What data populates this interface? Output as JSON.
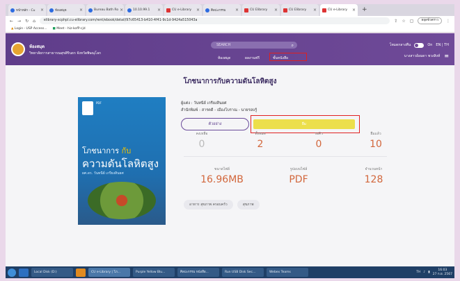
{
  "browser": {
    "tabs": [
      {
        "label": "หน้าหลัก - Cu",
        "icon": "page-icon",
        "active": false
      },
      {
        "label": "ห้องสมุด",
        "icon": "page-icon",
        "active": false
      },
      {
        "label": "Bureau Bath Ro",
        "icon": "page-icon",
        "active": false
      },
      {
        "label": "10.10.99.1",
        "icon": "page-icon",
        "active": false
      },
      {
        "label": "CU e-Library",
        "icon": "cu-icon",
        "active": false
      },
      {
        "label": "ศิลปะกรรม",
        "icon": "page-icon",
        "active": false
      },
      {
        "label": "CU Elibrary",
        "icon": "cu-icon",
        "active": false
      },
      {
        "label": "CU Elibrary",
        "icon": "cu-icon",
        "active": false
      },
      {
        "label": "CU e-Library",
        "icon": "cu-icon",
        "active": true
      }
    ],
    "new_tab": "+",
    "url": "elibrary-scphpl.cu-elibrary.com/rent/ebook/detail/97c65413-b410-4f41-9c1d-9424a515043a",
    "profile": "หยุดชั่วคราว",
    "bookmarks": [
      "Login - USP Access...",
      "Meet - hiz-kofP-cjd"
    ]
  },
  "header": {
    "brand": "ห้องสมุด",
    "subtitle": "วิทยาลัยการสาธารณสุขสิรินธร จังหวัดพิษณุโลก",
    "search_placeholder": "SEARCH",
    "nav": [
      "ห้องสมุด",
      "ผลงานฟรี",
      "ชั้นหนังสือ"
    ],
    "mode_label": "โหมดกลางคืน",
    "toggle_state": "On",
    "lang": "EN | TH",
    "user": "นางสาวอ้อมดา พวงสิงห์"
  },
  "book": {
    "title": "โภชนาการกับความดันโลหิตสูง",
    "author_line": "ผู้แต่ง : วันทนีย์ เกรียงสินยศ",
    "publisher_line": "สำนักพิมพ์ : สารคดี - เมืองโบราณ - นายรอบรู้",
    "sample_button": "ตัวอย่าง",
    "borrow_button": "ยืม",
    "cover": {
      "badge": "PDF",
      "line1_a": "โภชนาการ",
      "line1_b": "กับ",
      "line2": "ความดันโลหิตสูง",
      "authors": "ผศ.ดร. วันทนีย์ เกรียงสินยศ"
    },
    "stats": [
      {
        "label": "คงเหลือ",
        "value": "0"
      },
      {
        "label": "ทั้งหมด",
        "value": "2"
      },
      {
        "label": "รอคิว",
        "value": "0"
      },
      {
        "label": "ยืมแล้ว",
        "value": "10"
      }
    ],
    "details": [
      {
        "label": "ขนาดไฟล์",
        "value": "16.96MB"
      },
      {
        "label": "รูปแบบไฟล์",
        "value": "PDF"
      },
      {
        "label": "จำนวนหน้า",
        "value": "128"
      }
    ],
    "tags": [
      "อาหาร สุขภาพ ครอบครัว",
      "สุขภาพ"
    ]
  },
  "taskbar": {
    "items": [
      "Local Disk (D:)",
      "CU e-Library | โภ...",
      "Purple Yellow Blu...",
      "ศิลปะกรรม หนังสือ...",
      "Run USB Disk Sec...",
      "Webex Teams"
    ],
    "active_index": 1,
    "lang": "TH",
    "time": "16:03",
    "date": "27 ก.ย. 2567"
  },
  "colors": {
    "primary": "#6f4a98",
    "accent": "#d2673c",
    "borrow": "#ecdf4b",
    "highlight_box": "#e02020"
  }
}
